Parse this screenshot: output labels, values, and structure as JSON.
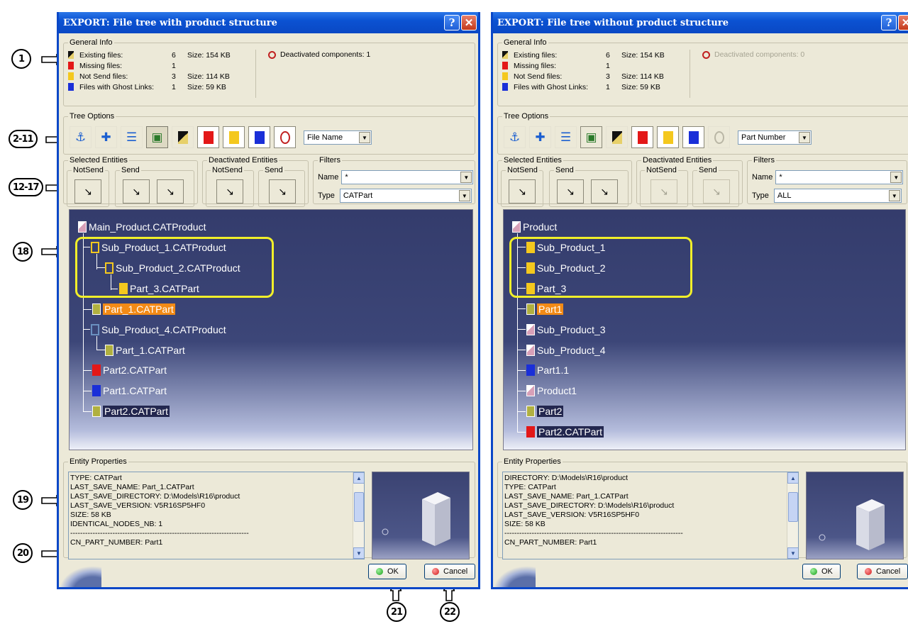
{
  "callouts": {
    "c1": "1",
    "c2": "2-11",
    "c3": "12-17",
    "c4": "18",
    "c5": "19",
    "c6": "20",
    "c7": "21",
    "c8": "22"
  },
  "left": {
    "title": "EXPORT:  File tree with product structure",
    "general_info_label": "General Info",
    "info": [
      {
        "label": "Existing files:",
        "count": "6",
        "size": "Size: 154 KB"
      },
      {
        "label": "Missing files:",
        "count": "1",
        "size": ""
      },
      {
        "label": "Not Send files:",
        "count": "3",
        "size": "Size: 114 KB"
      },
      {
        "label": "Files with Ghost Links:",
        "count": "1",
        "size": "Size: 59 KB"
      }
    ],
    "deactivated": "Deactivated components:  1",
    "tree_options_label": "Tree Options",
    "tree_option_select": "File Name",
    "selected_entities": "Selected Entities",
    "deactivated_entities": "Deactivated Entities",
    "filters": "Filters",
    "notsend": "NotSend",
    "send": "Send",
    "name_label": "Name",
    "name_value": "*",
    "type_label": "Type",
    "type_value": "CATPart",
    "tree": [
      "Main_Product.CATProduct",
      "Sub_Product_1.CATProduct",
      "Sub_Product_2.CATProduct",
      "Part_3.CATPart",
      "Part_1.CATPart",
      "Sub_Product_4.CATProduct",
      "Part_1.CATPart",
      "Part2.CATPart",
      "Part1.CATPart",
      "Part2.CATPart"
    ],
    "entity_properties": "Entity Properties",
    "props": [
      "TYPE: CATPart",
      "LAST_SAVE_NAME: Part_1.CATPart",
      "LAST_SAVE_DIRECTORY: D:\\Models\\R16\\product",
      "LAST_SAVE_VERSION: V5R16SP5HF0",
      "SIZE: 58 KB",
      "IDENTICAL_NODES_NB: 1",
      "------------------------------------------------------------------------",
      "CN_PART_NUMBER: Part1"
    ],
    "ok": "OK",
    "cancel": "Cancel"
  },
  "right": {
    "title": "EXPORT:  File tree without product structure",
    "general_info_label": "General Info",
    "info": [
      {
        "label": "Existing files:",
        "count": "6",
        "size": "Size: 154 KB"
      },
      {
        "label": "Missing files:",
        "count": "1",
        "size": ""
      },
      {
        "label": "Not Send files:",
        "count": "3",
        "size": "Size: 114 KB"
      },
      {
        "label": "Files with Ghost Links:",
        "count": "1",
        "size": "Size: 59 KB"
      }
    ],
    "deactivated": "Deactivated components:  0",
    "tree_options_label": "Tree Options",
    "tree_option_select": "Part Number",
    "selected_entities": "Selected Entities",
    "deactivated_entities": "Deactivated Entities",
    "filters": "Filters",
    "notsend": "NotSend",
    "send": "Send",
    "name_label": "Name",
    "name_value": "*",
    "type_label": "Type",
    "type_value": "ALL",
    "tree": [
      "Product",
      "Sub_Product_1",
      "Sub_Product_2",
      "Part_3",
      "Part1",
      "Sub_Product_3",
      "Sub_Product_4",
      "Part1.1",
      "Product1",
      "Part2",
      "Part2.CATPart"
    ],
    "entity_properties": "Entity Properties",
    "props": [
      "DIRECTORY: D:\\Models\\R16\\product",
      "TYPE: CATPart",
      "LAST_SAVE_NAME: Part_1.CATPart",
      "LAST_SAVE_DIRECTORY: D:\\Models\\R16\\product",
      "LAST_SAVE_VERSION: V5R16SP5HF0",
      "SIZE: 58 KB",
      "------------------------------------------------------------------------",
      "CN_PART_NUMBER: Part1"
    ],
    "ok": "OK",
    "cancel": "Cancel"
  },
  "colors": {
    "existing": "#111111",
    "missing": "#e31818",
    "notsend": "#f4c81e",
    "ghost": "#1a2fd8",
    "highlight_box": "#f1ef2a",
    "selected_node": "#f28a16"
  }
}
